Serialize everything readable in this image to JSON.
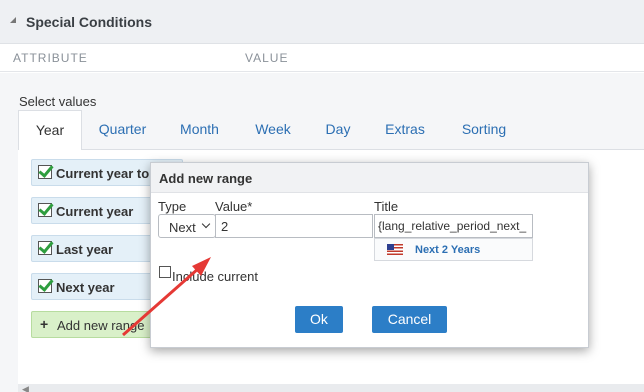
{
  "panel": {
    "title": "Special Conditions"
  },
  "columns": {
    "attribute": "ATTRIBUTE",
    "value": "VALUE"
  },
  "select_label": "Select values",
  "tabs": [
    {
      "label": "Year",
      "active": true
    },
    {
      "label": "Quarter"
    },
    {
      "label": "Month"
    },
    {
      "label": "Week"
    },
    {
      "label": "Day"
    },
    {
      "label": "Extras"
    },
    {
      "label": "Sorting"
    }
  ],
  "ranges": [
    {
      "label": "Current year to date"
    },
    {
      "label": "Current year"
    },
    {
      "label": "Last year"
    },
    {
      "label": "Next year"
    }
  ],
  "add_range_label": "Add new range",
  "dialog": {
    "title": "Add new range",
    "type_label": "Type",
    "type_value": "Next",
    "value_label": "Value*",
    "value_value": "2",
    "title_label": "Title",
    "title_value": "{lang_relative_period_next_",
    "title_preview": "Next 2 Years",
    "include_current_label": "Include current",
    "ok_label": "Ok",
    "cancel_label": "Cancel"
  },
  "colors": {
    "accent": "#2c7ec7",
    "link": "#2c6fb3",
    "arrow": "#e53935"
  }
}
